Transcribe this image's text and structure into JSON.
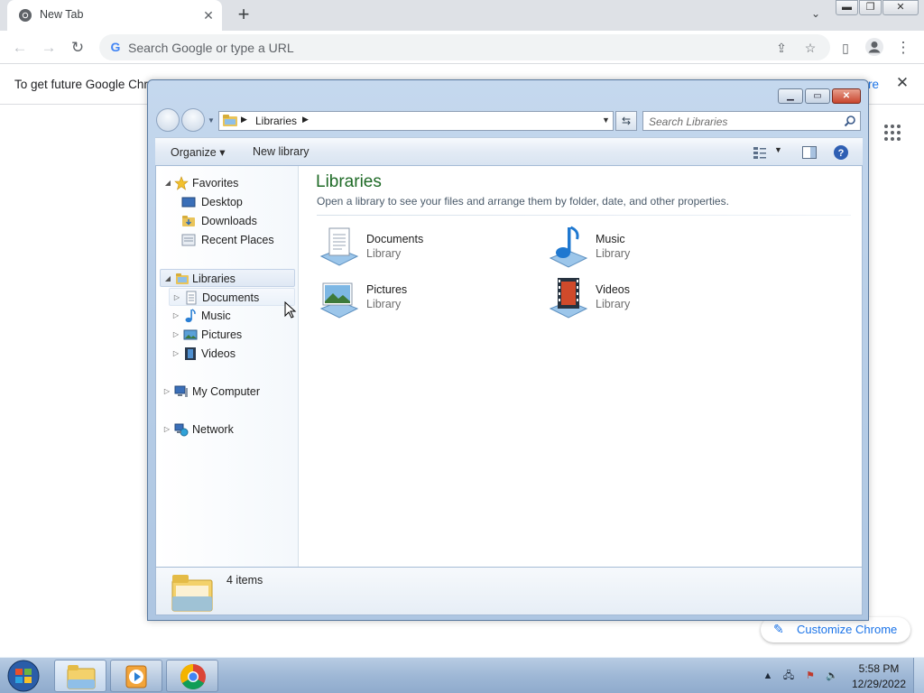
{
  "chrome": {
    "tab": {
      "title": "New Tab",
      "close_icon": "close-icon"
    },
    "new_tab_icon": "plus-icon",
    "omnibox": {
      "placeholder": "Search Google or type a URL",
      "value": ""
    },
    "infobar": {
      "message": "To get future Google Chro",
      "link_tail": "re"
    },
    "customize": {
      "label": "Customize Chrome"
    },
    "window_controls": {
      "minimize": "minimize-icon",
      "restore": "restore-icon",
      "close": "close-icon"
    }
  },
  "explorer": {
    "breadcrumb": [
      "Libraries"
    ],
    "search": {
      "placeholder": "Search Libraries",
      "value": ""
    },
    "toolbar": {
      "organize": "Organize",
      "new_library": "New library"
    },
    "nav": {
      "favorites": {
        "label": "Favorites",
        "items": [
          "Desktop",
          "Downloads",
          "Recent Places"
        ]
      },
      "libraries": {
        "label": "Libraries",
        "items": [
          "Documents",
          "Music",
          "Pictures",
          "Videos"
        ]
      },
      "computer": "My Computer",
      "network": "Network"
    },
    "main": {
      "title": "Libraries",
      "description": "Open a library to see your files and arrange them by folder, date, and other properties.",
      "tiles": [
        {
          "name": "Documents",
          "sub": "Library",
          "icon": "documents-library-icon"
        },
        {
          "name": "Music",
          "sub": "Library",
          "icon": "music-library-icon"
        },
        {
          "name": "Pictures",
          "sub": "Library",
          "icon": "pictures-library-icon"
        },
        {
          "name": "Videos",
          "sub": "Library",
          "icon": "videos-library-icon"
        }
      ]
    },
    "details": {
      "count_text": "4 items"
    }
  },
  "taskbar": {
    "clock": {
      "time": "5:58 PM",
      "date": "12/29/2022"
    },
    "buttons": [
      "windows-explorer",
      "media-player",
      "google-chrome"
    ]
  },
  "colors": {
    "chrome_accent": "#1a73e8",
    "explorer_title_green": "#1e6a26",
    "explorer_cmd_blue": "#1e3287"
  }
}
